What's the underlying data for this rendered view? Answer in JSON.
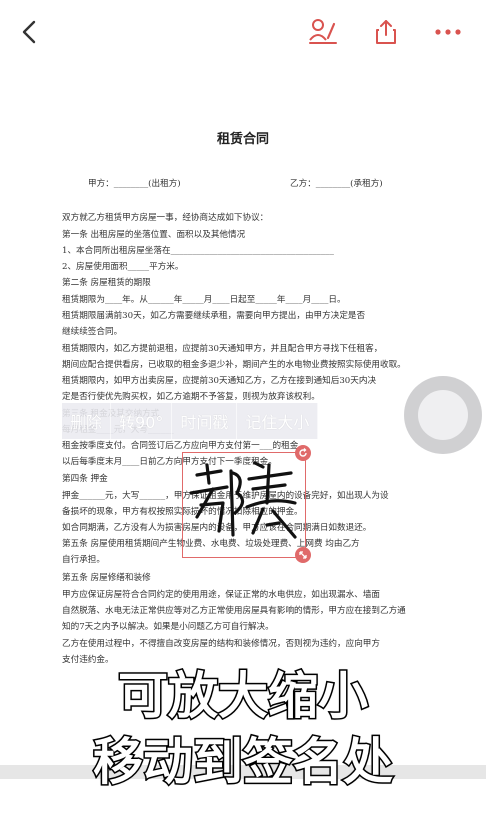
{
  "doc": {
    "title": "租赁合同",
    "party_line_a": "甲方：________(出租方)",
    "party_line_b": "乙方：________(承租方)",
    "lines": [
      "双方就乙方租赁甲方房屋一事，经协商达成如下协议：",
      "第一条  出租房屋的坐落位置、面积以及其他情况",
      "1、本合同所出租房屋坐落在______________________________________",
      "2、房屋使用面积_____平方米。",
      "第二条  房屋租赁的期限",
      "租赁期限为____年。从______年_____月____日起至_____年____月____日。",
      "租赁期限届满前30天，如乙方需要继续承租，需要向甲方提出，由甲方决定是否",
      "继续续签合同。",
      "租赁期限内，如乙方提前退租，应提前30天通知甲方，并且配合甲方寻找下任租客，",
      "期间应配合提供看房，已收取的租金多退少补，期间产生的水电物业费按照实际使用收取。",
      "租赁期限内，如甲方出卖房屋，应提前30天通知乙方，乙方在接到通知后30天内决",
      "定是否行使优先购买权，如乙方逾期不予答复，则视为放弃该权利。",
      "第三条  租金及其交纳方式",
      "每月租金____元，大写______",
      "租金按季度支付。合同签订后乙方应向甲方支付第一___的租金。",
      "以后每季度末月____日前乙方向甲方支付下一季度租金。",
      "第四条  押金",
      "押金______元，大写______，甲方保证租金用于维护房屋内的设备完好，如出现人为设",
      "备损坏的现象，甲方有权按照实际损坏的情况扣除相应的押金。",
      "如合同期满，乙方没有人为损害房屋内的设备，甲方应该在合同期满日如数退还。",
      "第五条  房屋使用租赁期间产生物业费、水电费、垃圾处理费、上网费  均由乙方",
      "自行承担。",
      "第五条  房屋修缮和装修",
      "甲方应保证房屋符合合同约定的使用用途，保证正常的水电供应，如出现漏水、墙面",
      "自然脱落、水电无法正常供应等对乙方正常使用房屋具有影响的情形，甲方应在接到乙方通",
      "知的7天之内予以解决。如果是小问题乙方可自行解决。",
      "乙方在使用过程中，不得擅自改变房屋的结构和装修情况，否则视为违约，应向甲方",
      "支付违约金。"
    ]
  },
  "toolbar": {
    "back_icon": "chevron-left-icon",
    "sign_icon": "signature-person-icon",
    "share_icon": "share-icon",
    "more_icon": "more-dots-icon",
    "accent": "#d9534f"
  },
  "float_toolbar": {
    "delete_label": "删除",
    "rotate_label": "转90°",
    "timestamp_label": "时间戳",
    "remember_size_label": "记住大小"
  },
  "signature": {
    "text": "郝寒"
  },
  "caption": {
    "line1": "可放大缩小",
    "line2": "移动到签名处"
  }
}
